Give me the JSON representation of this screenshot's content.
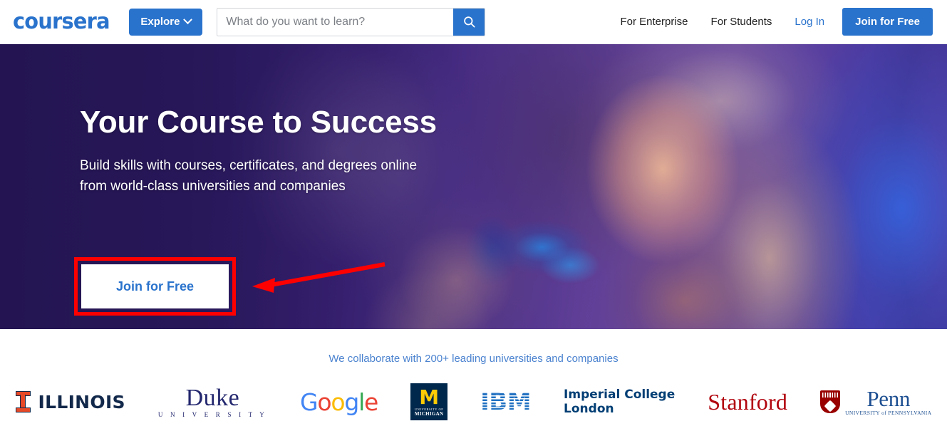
{
  "header": {
    "brand": "coursera",
    "explore_label": "Explore",
    "explore_icon": "chevron-down-icon",
    "search": {
      "placeholder": "What do you want to learn?",
      "value": "",
      "button_icon": "search-icon"
    },
    "nav": [
      {
        "label": "For Enterprise",
        "style": "plain"
      },
      {
        "label": "For Students",
        "style": "plain"
      },
      {
        "label": "Log In",
        "style": "link"
      }
    ],
    "join_label": "Join for Free"
  },
  "hero": {
    "title": "Your Course to Success",
    "subtitle": "Build skills with courses, certificates, and degrees online from world-class universities and companies",
    "cta_label": "Join for Free",
    "annotation": {
      "type": "highlight-box-with-arrow",
      "color": "#ff0000",
      "target": "Join for Free"
    }
  },
  "partners": {
    "caption": "We collaborate with 200+ leading universities and companies",
    "logos": [
      {
        "name": "illinois",
        "label": "ILLINOIS"
      },
      {
        "name": "duke",
        "label": "Duke",
        "sub": "U N I V E R S I T Y"
      },
      {
        "name": "google",
        "letters": [
          "G",
          "o",
          "o",
          "g",
          "l",
          "e"
        ]
      },
      {
        "name": "michigan",
        "letter": "M",
        "line1": "UNIVERSITY OF",
        "line2": "MICHIGAN"
      },
      {
        "name": "ibm",
        "label": "IBM"
      },
      {
        "name": "imperial-college-london",
        "line1": "Imperial College",
        "line2": "London"
      },
      {
        "name": "stanford",
        "label": "Stanford"
      },
      {
        "name": "penn",
        "label": "Penn",
        "sub": "UNIVERSITY of PENNSYLVANIA"
      }
    ]
  },
  "colors": {
    "brand_blue": "#2a73cc",
    "hero_purple": "#2c1a63",
    "annotation_red": "#ff0000",
    "caption_blue": "#4a82cf"
  }
}
